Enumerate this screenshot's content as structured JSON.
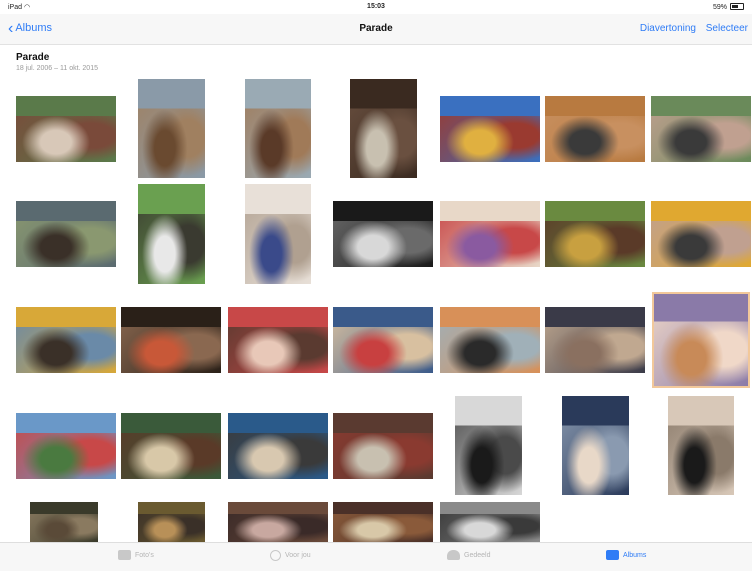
{
  "status_bar": {
    "left": "iPad",
    "time": "15:03",
    "right": "59%"
  },
  "nav": {
    "back_label": "Albums",
    "title": "Parade",
    "slideshow_label": "Diavertoning",
    "select_label": "Selecteer"
  },
  "album": {
    "title": "Parade",
    "subtitle": "18 jul. 2006 – 11 okt. 2015"
  },
  "tabs": {
    "photos": "Foto's",
    "for_you": "Voor jou",
    "shared": "Gedeeld",
    "albums": "Albums"
  },
  "colors": {
    "accent": "#2f7cf6"
  },
  "photos": [
    {
      "name": "photo-1-1",
      "colors": [
        "#5a7a4a",
        "#d8c8b8",
        "#7a4a3a"
      ]
    },
    {
      "name": "photo-1-2",
      "colors": [
        "#8a9aa8",
        "#6a4a30",
        "#a08060"
      ]
    },
    {
      "name": "photo-1-3",
      "colors": [
        "#9aaab4",
        "#5a3a28",
        "#a07a58"
      ]
    },
    {
      "name": "photo-1-4",
      "colors": [
        "#3a2a20",
        "#c8c0b0",
        "#6a5040"
      ]
    },
    {
      "name": "photo-1-5",
      "colors": [
        "#3a70c0",
        "#e0b040",
        "#9a3a30"
      ]
    },
    {
      "name": "photo-1-6",
      "colors": [
        "#b87a40",
        "#3a3a3a",
        "#c89060"
      ]
    },
    {
      "name": "photo-1-7",
      "colors": [
        "#6a8a5a",
        "#3a3a3a",
        "#c0a090"
      ]
    },
    {
      "name": "photo-2-1",
      "colors": [
        "#5a6a70",
        "#3a3028",
        "#8a9870"
      ]
    },
    {
      "name": "photo-2-2",
      "colors": [
        "#6aa050",
        "#e8e8e8",
        "#3a3a30"
      ]
    },
    {
      "name": "photo-2-3",
      "colors": [
        "#e8e0d8",
        "#3a4a8a",
        "#b0a090"
      ]
    },
    {
      "name": "photo-2-4",
      "colors": [
        "#1a1a1a",
        "#d8d8d8",
        "#6a6a6a"
      ]
    },
    {
      "name": "photo-2-5",
      "colors": [
        "#e8d8c8",
        "#8a5aa0",
        "#c84848"
      ]
    },
    {
      "name": "photo-2-6",
      "colors": [
        "#6a8a40",
        "#c8a040",
        "#5a3a28"
      ]
    },
    {
      "name": "photo-2-7",
      "colors": [
        "#e0a830",
        "#3a3a3a",
        "#c0a090"
      ]
    },
    {
      "name": "photo-3-1",
      "colors": [
        "#d8a838",
        "#3a3028",
        "#6a8aa8"
      ]
    },
    {
      "name": "photo-3-2",
      "colors": [
        "#2a2018",
        "#c85838",
        "#8a6850"
      ]
    },
    {
      "name": "photo-3-3",
      "colors": [
        "#c84848",
        "#e8c8b8",
        "#5a3a30"
      ]
    },
    {
      "name": "photo-3-4",
      "colors": [
        "#3a5a8a",
        "#c84040",
        "#d8c0a0"
      ]
    },
    {
      "name": "photo-3-5",
      "colors": [
        "#d89058",
        "#2a2a2a",
        "#a0b0b8"
      ]
    },
    {
      "name": "photo-3-6",
      "colors": [
        "#3a3a48",
        "#8a7060",
        "#c0a890"
      ]
    },
    {
      "name": "photo-3-7",
      "colors": [
        "#8a7aa8",
        "#c88a58",
        "#f0d8c8"
      ]
    },
    {
      "name": "photo-4-1",
      "colors": [
        "#6a98c8",
        "#4a7a40",
        "#c84848"
      ]
    },
    {
      "name": "photo-4-2",
      "colors": [
        "#3a5a3a",
        "#d8c8a8",
        "#5a3a28"
      ]
    },
    {
      "name": "photo-4-3",
      "colors": [
        "#2a5a8a",
        "#d8c8b0",
        "#3a3a3a"
      ]
    },
    {
      "name": "photo-4-4",
      "colors": [
        "#5a3a30",
        "#c8c0b0",
        "#8a3a30"
      ]
    },
    {
      "name": "photo-4-5",
      "colors": [
        "#d8d8d8",
        "#1a1a1a",
        "#4a4a4a"
      ]
    },
    {
      "name": "photo-4-6",
      "colors": [
        "#2a3a5a",
        "#e8d8c8",
        "#8a9ab0"
      ]
    },
    {
      "name": "photo-4-7",
      "colors": [
        "#d8c8b8",
        "#1a1a1a",
        "#8a7a6a"
      ]
    },
    {
      "name": "photo-5-1",
      "colors": [
        "#3a3a2a",
        "#5a4a38",
        "#8a7a60"
      ]
    },
    {
      "name": "photo-5-2",
      "colors": [
        "#6a5a30",
        "#b89058",
        "#3a3028"
      ]
    },
    {
      "name": "photo-5-3",
      "colors": [
        "#6a4a3a",
        "#c8a8a0",
        "#3a2a28"
      ]
    },
    {
      "name": "photo-5-4",
      "colors": [
        "#4a3028",
        "#d8c8a8",
        "#8a5a3a"
      ]
    },
    {
      "name": "photo-5-5",
      "colors": [
        "#8a8a8a",
        "#d8d8d8",
        "#3a3a3a"
      ]
    }
  ]
}
